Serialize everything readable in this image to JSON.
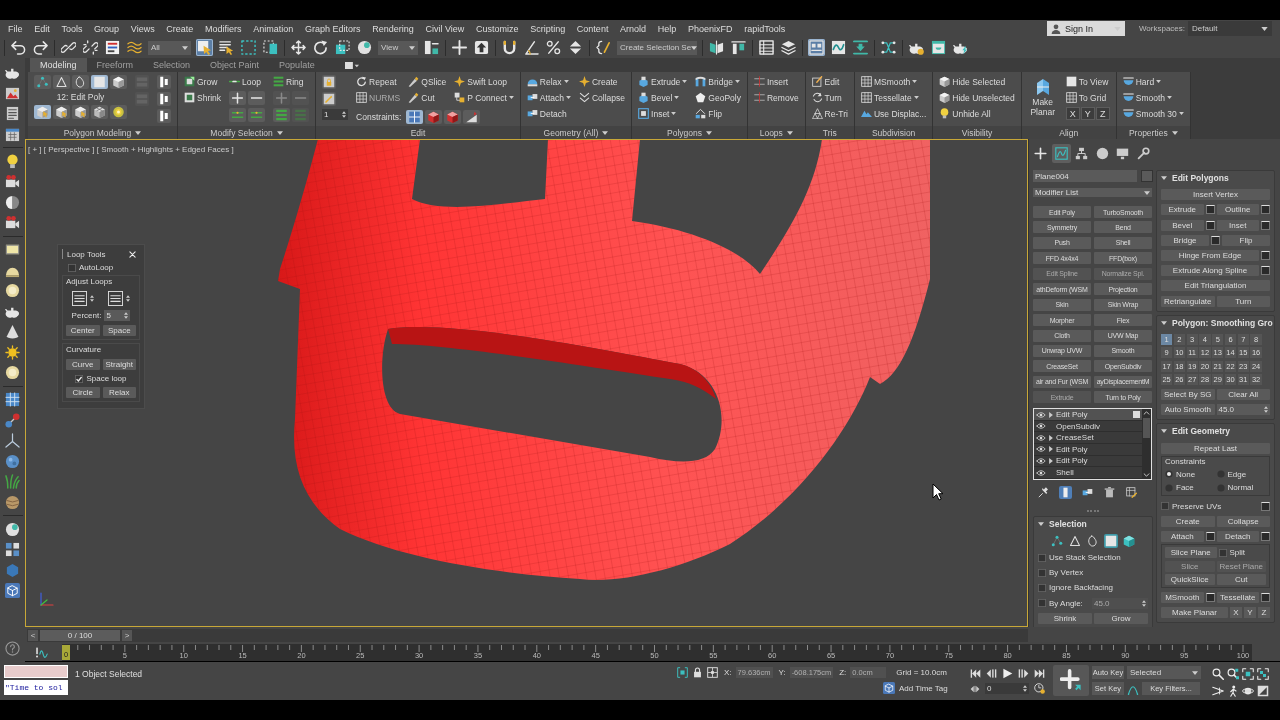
{
  "menu_bar": {
    "items": [
      "File",
      "Edit",
      "Tools",
      "Group",
      "Views",
      "Create",
      "Modifiers",
      "Animation",
      "Graph Editors",
      "Rendering",
      "Civil View",
      "Customize",
      "Scripting",
      "Content",
      "Arnold",
      "Help",
      "PhoenixFD",
      "rapidTools"
    ],
    "sign_in": "Sign In",
    "workspaces_label": "Workspaces:",
    "workspace": "Default"
  },
  "main_toolbar": {
    "selection_filter": "All",
    "select_object": true,
    "reference_coordinate": "View",
    "named_selection": "Create Selection Se",
    "ribbon_toggle": true
  },
  "ribbon": {
    "tabs": [
      {
        "label": "Modeling",
        "selected": true
      },
      {
        "label": "Freeform",
        "selected": false
      },
      {
        "label": "Selection",
        "selected": false
      },
      {
        "label": "Object Paint",
        "selected": false
      },
      {
        "label": "Populate",
        "selected": false
      }
    ],
    "panels": [
      {
        "title": "Polygon Modeling",
        "dropdown": true,
        "columns": [
          [
            {
              "kind": "tools",
              "tools": [
                {
                  "selected": false
                },
                {
                  "selected": false
                },
                {
                  "selected": false
                },
                {
                  "selected": true
                },
                {
                  "selected": false
                }
              ]
            },
            {
              "kind": "text",
              "label": "12: Edit Poly"
            },
            {
              "kind": "tools",
              "tools": [
                {
                  "selected": true
                },
                {
                  "selected": false
                },
                {
                  "selected": false
                },
                {
                  "selected": false
                },
                {
                  "selected": false
                }
              ]
            }
          ],
          [
            {
              "kind": "tool",
              "disabled": true
            },
            {
              "kind": "tool",
              "disabled": true
            }
          ],
          [
            {
              "kind": "tool",
              "disabled": false
            },
            {
              "kind": "tool",
              "disabled": false
            },
            {
              "kind": "tool",
              "disabled": false
            }
          ]
        ]
      },
      {
        "title": "Modify Selection",
        "dropdown": true,
        "columns": [
          [
            {
              "kind": "button",
              "label": "Grow",
              "dropdown": false,
              "disabled": false
            },
            {
              "kind": "button",
              "label": "Shrink",
              "dropdown": false,
              "disabled": false
            }
          ],
          [
            {
              "kind": "button",
              "label": "Loop",
              "dropdown": false,
              "disabled": false
            },
            {
              "kind": "tools",
              "tools": [
                {
                  "disabled": false
                },
                {
                  "disabled": false
                }
              ]
            },
            {
              "kind": "tools",
              "tools": [
                {
                  "disabled": false
                },
                {
                  "disabled": false
                }
              ]
            }
          ],
          [
            {
              "kind": "button",
              "label": "Ring",
              "dropdown": false,
              "disabled": false
            },
            {
              "kind": "tools",
              "tools": [
                {
                  "disabled": true
                },
                {
                  "disabled": true
                }
              ]
            },
            {
              "kind": "tools",
              "tools": [
                {
                  "disabled": false
                },
                {
                  "disabled": true
                }
              ]
            }
          ]
        ]
      },
      {
        "title": "Edit",
        "dropdown": false,
        "columns": [
          [
            {
              "kind": "tool",
              "disabled": false
            },
            {
              "kind": "tool",
              "disabled": false
            },
            {
              "kind": "spinner",
              "value": "1"
            }
          ],
          [
            {
              "kind": "button",
              "label": "Repeat",
              "dropdown": false,
              "disabled": false
            },
            {
              "kind": "button",
              "label": "NURMS",
              "dropdown": false,
              "disabled": true
            }
          ],
          [
            {
              "kind": "button",
              "label": "QSlice",
              "dropdown": false,
              "disabled": false
            },
            {
              "kind": "button",
              "label": "Cut",
              "dropdown": false,
              "disabled": false
            }
          ],
          [
            {
              "kind": "button",
              "label": "Swift Loop",
              "dropdown": false,
              "disabled": false
            },
            {
              "kind": "button",
              "label": "P Connect",
              "dropdown": true,
              "disabled": false
            }
          ]
        ],
        "footer": {
          "label": "Constraints:",
          "tools": [
            {
              "selected": true
            },
            {
              "selected": false
            },
            {
              "selected": false
            },
            {
              "selected": false
            }
          ]
        }
      },
      {
        "title": "Geometry (All)",
        "dropdown": true,
        "columns": [
          [
            {
              "kind": "button",
              "label": "Relax",
              "dropdown": true,
              "disabled": false
            },
            {
              "kind": "button",
              "label": "Attach",
              "dropdown": true,
              "disabled": false
            },
            {
              "kind": "button",
              "label": "Detach",
              "dropdown": false,
              "disabled": false
            }
          ],
          [
            {
              "kind": "button",
              "label": "Create",
              "dropdown": false,
              "disabled": false
            },
            {
              "kind": "button",
              "label": "Collapse",
              "dropdown": false,
              "disabled": false
            }
          ]
        ]
      },
      {
        "title": "Polygons",
        "dropdown": true,
        "columns": [
          [
            {
              "kind": "button",
              "label": "Extrude",
              "dropdown": true,
              "disabled": false
            },
            {
              "kind": "button",
              "label": "Bevel",
              "dropdown": true,
              "disabled": false
            },
            {
              "kind": "button",
              "label": "Inset",
              "dropdown": true,
              "disabled": false
            }
          ],
          [
            {
              "kind": "button",
              "label": "Bridge",
              "dropdown": true,
              "disabled": false
            },
            {
              "kind": "button",
              "label": "GeoPoly",
              "dropdown": false,
              "disabled": false
            },
            {
              "kind": "button",
              "label": "Flip",
              "dropdown": false,
              "disabled": false
            }
          ]
        ]
      },
      {
        "title": "Loops",
        "dropdown": true,
        "columns": [
          [
            {
              "kind": "button",
              "label": "Insert",
              "dropdown": false,
              "disabled": false
            },
            {
              "kind": "button",
              "label": "Remove",
              "dropdown": false,
              "disabled": false
            }
          ]
        ]
      },
      {
        "title": "Tris",
        "dropdown": false,
        "columns": [
          [
            {
              "kind": "button",
              "label": "Edit",
              "dropdown": false,
              "disabled": false
            },
            {
              "kind": "button",
              "label": "Turn",
              "dropdown": false,
              "disabled": false
            },
            {
              "kind": "button",
              "label": "Re-Tri",
              "dropdown": false,
              "disabled": false
            }
          ]
        ]
      },
      {
        "title": "Subdivision",
        "dropdown": false,
        "columns": [
          [
            {
              "kind": "button",
              "label": "MSmooth",
              "dropdown": true,
              "disabled": false
            },
            {
              "kind": "button",
              "label": "Tessellate",
              "dropdown": true,
              "disabled": false
            },
            {
              "kind": "button",
              "label": "Use Displac...",
              "dropdown": false,
              "disabled": false
            }
          ]
        ]
      },
      {
        "title": "Visibility",
        "dropdown": false,
        "columns": [
          [
            {
              "kind": "button",
              "label": "Hide Selected",
              "dropdown": false,
              "disabled": false
            },
            {
              "kind": "button",
              "label": "Hide Unselected",
              "dropdown": false,
              "disabled": false
            },
            {
              "kind": "button",
              "label": "Unhide All",
              "dropdown": false,
              "disabled": false
            }
          ]
        ]
      },
      {
        "title": "Align",
        "dropdown": false,
        "columns": [
          [
            {
              "kind": "big",
              "label": "Make Planar"
            }
          ],
          [
            {
              "kind": "button",
              "label": "To View",
              "dropdown": false,
              "disabled": false
            },
            {
              "kind": "button",
              "label": "To Grid",
              "dropdown": false,
              "disabled": false
            },
            {
              "kind": "keys",
              "labels": [
                "X",
                "Y",
                "Z"
              ]
            }
          ]
        ]
      },
      {
        "title": "Properties",
        "dropdown": true,
        "columns": [
          [
            {
              "kind": "button",
              "label": "Hard",
              "dropdown": true,
              "disabled": false
            },
            {
              "kind": "button",
              "label": "Smooth",
              "dropdown": true,
              "disabled": false
            },
            {
              "kind": "button",
              "label": "Smooth 30",
              "dropdown": true,
              "disabled": false
            }
          ]
        ]
      }
    ]
  },
  "viewport": {
    "label": "[ + ] [ Perspective ] [ Smooth + Highlights + Edged Faces ]",
    "active": true
  },
  "loop_tools": {
    "title": "Loop Tools",
    "autoloop": {
      "label": "AutoLoop",
      "checked": false
    },
    "adjust_loops": {
      "label": "Adjust Loops",
      "percent_label": "Percent:",
      "percent": "5",
      "buttons": [
        "Center",
        "Space"
      ]
    },
    "curvature": {
      "label": "Curvature",
      "buttons_top": [
        "Curve",
        "Straight"
      ],
      "space_loop": {
        "label": "Space loop",
        "checked": true
      },
      "buttons_bottom": [
        "Circle",
        "Relax"
      ]
    }
  },
  "command_panel": {
    "tabs": [
      {
        "selected": false
      },
      {
        "selected": true
      },
      {
        "selected": false
      },
      {
        "selected": false
      },
      {
        "selected": false
      },
      {
        "selected": false
      }
    ],
    "object_name": "Plane004",
    "modifier_list": "Modifier List",
    "modifier_buttons": [
      {
        "label": "Edit Poly",
        "disabled": false
      },
      {
        "label": "TurboSmooth",
        "disabled": false
      },
      {
        "label": "Symmetry",
        "disabled": false
      },
      {
        "label": "Bend",
        "disabled": false
      },
      {
        "label": "Push",
        "disabled": false
      },
      {
        "label": "Shell",
        "disabled": false
      },
      {
        "label": "FFD 4x4x4",
        "disabled": false
      },
      {
        "label": "FFD(box)",
        "disabled": false
      },
      {
        "label": "Edit Spline",
        "disabled": true
      },
      {
        "label": "Normalize Spl.",
        "disabled": true
      },
      {
        "label": "athDeform (WSM",
        "disabled": false
      },
      {
        "label": "Projection",
        "disabled": false
      },
      {
        "label": "Skin",
        "disabled": false
      },
      {
        "label": "Skin Wrap",
        "disabled": false
      },
      {
        "label": "Morpher",
        "disabled": false
      },
      {
        "label": "Flex",
        "disabled": false
      },
      {
        "label": "Cloth",
        "disabled": false
      },
      {
        "label": "UVW Map",
        "disabled": false
      },
      {
        "label": "Unwrap UVW",
        "disabled": false
      },
      {
        "label": "Smooth",
        "disabled": false
      },
      {
        "label": "CreaseSet",
        "disabled": false
      },
      {
        "label": "OpenSubdiv",
        "disabled": false
      },
      {
        "label": "air and Fur (WSM",
        "disabled": false
      },
      {
        "label": "ayDisplacementM",
        "disabled": false
      },
      {
        "label": "Extrude",
        "disabled": true
      },
      {
        "label": "Turn to Poly",
        "disabled": false
      }
    ],
    "stack": [
      {
        "label": "Edit Poly",
        "expandable": true,
        "selected": true
      },
      {
        "label": "OpenSubdiv",
        "expandable": false,
        "selected": false
      },
      {
        "label": "CreaseSet",
        "expandable": true,
        "selected": false
      },
      {
        "label": "Edit Poly",
        "expandable": true,
        "selected": false
      },
      {
        "label": "Edit Poly",
        "expandable": true,
        "selected": false
      },
      {
        "label": "Shell",
        "expandable": false,
        "selected": false
      }
    ],
    "stack_tools": [
      {
        "selected": false
      },
      {
        "selected": true
      },
      {
        "selected": false
      },
      {
        "selected": false
      },
      {
        "selected": false
      }
    ],
    "selection_rollout": {
      "title": "Selection",
      "rows": [
        {
          "kind": "tools",
          "tools": [
            {
              "selected": false
            },
            {
              "selected": false
            },
            {
              "selected": false
            },
            {
              "selected": true
            },
            {
              "selected": false
            }
          ]
        },
        {
          "kind": "row",
          "items": [
            {
              "kind": "check",
              "label": "Use Stack Selection",
              "checked": false
            }
          ]
        },
        {
          "kind": "row",
          "items": [
            {
              "kind": "check",
              "label": "By Vertex",
              "checked": false
            }
          ]
        },
        {
          "kind": "row",
          "items": [
            {
              "kind": "check",
              "label": "Ignore Backfacing",
              "checked": false
            }
          ]
        },
        {
          "kind": "row",
          "items": [
            {
              "kind": "check",
              "label": "By Angle:",
              "checked": false
            },
            {
              "kind": "spinner",
              "value": "45.0",
              "disabled": true
            }
          ]
        },
        {
          "kind": "row",
          "items": [
            {
              "kind": "button",
              "label": "Shrink",
              "disabled": false
            },
            {
              "kind": "button",
              "label": "Grow",
              "disabled": false
            }
          ]
        }
      ]
    },
    "rollouts": [
      {
        "title": "Edit Polygons",
        "rows": [
          {
            "kind": "row",
            "items": [
              {
                "kind": "button",
                "label": "Insert Vertex",
                "disabled": false
              }
            ]
          },
          {
            "kind": "row",
            "items": [
              {
                "kind": "button",
                "label": "Extrude",
                "disabled": false
              },
              {
                "kind": "settings"
              },
              {
                "kind": "button",
                "label": "Outline",
                "disabled": false
              },
              {
                "kind": "settings"
              }
            ]
          },
          {
            "kind": "row",
            "items": [
              {
                "kind": "button",
                "label": "Bevel",
                "disabled": false
              },
              {
                "kind": "settings"
              },
              {
                "kind": "button",
                "label": "Inset",
                "disabled": false
              },
              {
                "kind": "settings"
              }
            ]
          },
          {
            "kind": "row",
            "items": [
              {
                "kind": "button",
                "label": "Bridge",
                "disabled": false
              },
              {
                "kind": "settings"
              },
              {
                "kind": "button",
                "label": "Flip",
                "disabled": false
              }
            ]
          },
          {
            "kind": "row",
            "items": [
              {
                "kind": "button",
                "label": "Hinge From Edge",
                "disabled": false
              },
              {
                "kind": "settings"
              }
            ]
          },
          {
            "kind": "row",
            "items": [
              {
                "kind": "button",
                "label": "Extrude Along Spline",
                "disabled": false
              },
              {
                "kind": "settings"
              }
            ]
          },
          {
            "kind": "row",
            "items": [
              {
                "kind": "button",
                "label": "Edit Triangulation",
                "disabled": false
              }
            ]
          },
          {
            "kind": "row",
            "items": [
              {
                "kind": "button",
                "label": "Retriangulate",
                "disabled": false
              },
              {
                "kind": "button",
                "label": "Turn",
                "disabled": false
              }
            ]
          }
        ]
      },
      {
        "title": "Polygon: Smoothing Gro",
        "rows": [
          {
            "kind": "groups",
            "groups": [
              {
                "label": "1",
                "selected": true
              },
              {
                "label": "2",
                "selected": false
              },
              {
                "label": "3",
                "selected": false
              },
              {
                "label": "4",
                "selected": false
              },
              {
                "label": "5",
                "selected": false
              },
              {
                "label": "6",
                "selected": false
              },
              {
                "label": "7",
                "selected": false
              },
              {
                "label": "8",
                "selected": false
              },
              {
                "label": "9",
                "selected": false
              },
              {
                "label": "10",
                "selected": false
              },
              {
                "label": "11",
                "selected": false
              },
              {
                "label": "12",
                "selected": false
              },
              {
                "label": "13",
                "selected": false
              },
              {
                "label": "14",
                "selected": false
              },
              {
                "label": "15",
                "selected": false
              },
              {
                "label": "16",
                "selected": false
              },
              {
                "label": "17",
                "selected": false
              },
              {
                "label": "18",
                "selected": false
              },
              {
                "label": "19",
                "selected": false
              },
              {
                "label": "20",
                "selected": false
              },
              {
                "label": "21",
                "selected": false
              },
              {
                "label": "22",
                "selected": false
              },
              {
                "label": "23",
                "selected": false
              },
              {
                "label": "24",
                "selected": false
              },
              {
                "label": "25",
                "selected": false
              },
              {
                "label": "26",
                "selected": false
              },
              {
                "label": "27",
                "selected": false
              },
              {
                "label": "28",
                "selected": false
              },
              {
                "label": "29",
                "selected": false
              },
              {
                "label": "30",
                "selected": false
              },
              {
                "label": "31",
                "selected": false
              },
              {
                "label": "32",
                "selected": false
              }
            ]
          },
          {
            "kind": "row",
            "items": [
              {
                "kind": "button",
                "label": "Select By SG",
                "disabled": false
              },
              {
                "kind": "button",
                "label": "Clear All",
                "disabled": false
              }
            ]
          },
          {
            "kind": "row",
            "items": [
              {
                "kind": "button",
                "label": "Auto Smooth",
                "disabled": false
              },
              {
                "kind": "spinner",
                "value": "45.0",
                "disabled": false
              }
            ]
          }
        ]
      },
      {
        "title": "Edit Geometry",
        "rows": [
          {
            "kind": "row",
            "items": [
              {
                "kind": "button",
                "label": "Repeat Last",
                "disabled": false
              }
            ]
          },
          {
            "kind": "group",
            "label": "Constraints",
            "rows": [
              {
                "kind": "row",
                "items": [
                  {
                    "kind": "radio",
                    "label": "None",
                    "selected": true
                  },
                  {
                    "kind": "radio",
                    "label": "Edge",
                    "selected": false
                  }
                ]
              },
              {
                "kind": "row",
                "items": [
                  {
                    "kind": "radio",
                    "label": "Face",
                    "selected": false
                  },
                  {
                    "kind": "radio",
                    "label": "Normal",
                    "selected": false
                  }
                ]
              }
            ]
          },
          {
            "kind": "row",
            "items": [
              {
                "kind": "check",
                "label": "Preserve UVs",
                "checked": false
              },
              {
                "kind": "settings"
              }
            ]
          },
          {
            "kind": "row",
            "items": [
              {
                "kind": "button",
                "label": "Create",
                "disabled": false
              },
              {
                "kind": "button",
                "label": "Collapse",
                "disabled": false
              }
            ]
          },
          {
            "kind": "row",
            "items": [
              {
                "kind": "button",
                "label": "Attach",
                "disabled": false
              },
              {
                "kind": "settings"
              },
              {
                "kind": "button",
                "label": "Detach",
                "disabled": false
              },
              {
                "kind": "settings"
              }
            ]
          },
          {
            "kind": "group",
            "rows": [
              {
                "kind": "row",
                "items": [
                  {
                    "kind": "button",
                    "label": "Slice Plane",
                    "disabled": false
                  },
                  {
                    "kind": "check",
                    "label": "Split",
                    "checked": false
                  }
                ]
              },
              {
                "kind": "row",
                "items": [
                  {
                    "kind": "button",
                    "label": "Slice",
                    "disabled": true
                  },
                  {
                    "kind": "button",
                    "label": "Reset Plane",
                    "disabled": true
                  }
                ]
              },
              {
                "kind": "row",
                "items": [
                  {
                    "kind": "button",
                    "label": "QuickSlice",
                    "disabled": false
                  },
                  {
                    "kind": "button",
                    "label": "Cut",
                    "disabled": false
                  }
                ]
              }
            ]
          },
          {
            "kind": "row",
            "items": [
              {
                "kind": "button",
                "label": "MSmooth",
                "disabled": false
              },
              {
                "kind": "settings"
              },
              {
                "kind": "button",
                "label": "Tessellate",
                "disabled": false
              },
              {
                "kind": "settings"
              }
            ]
          },
          {
            "kind": "row",
            "items": [
              {
                "kind": "button",
                "label": "Make Planar",
                "disabled": false
              },
              {
                "kind": "key",
                "label": "X"
              },
              {
                "kind": "key",
                "label": "Y"
              },
              {
                "kind": "key",
                "label": "Z"
              }
            ]
          }
        ]
      }
    ]
  },
  "time_slider": {
    "prev": "<",
    "position": "0 / 100",
    "next": ">"
  },
  "track_bar": {
    "labels": [
      "0",
      "5",
      "10",
      "15",
      "20",
      "25",
      "30",
      "35",
      "40",
      "45",
      "50",
      "55",
      "60",
      "65",
      "70",
      "75",
      "80",
      "85",
      "90",
      "95",
      "100"
    ]
  },
  "status_bar": {
    "listener_input": "\"Time to sol",
    "prompt": "1 Object Selected",
    "coordinates": [
      {
        "axis": "X:",
        "value": "79.636cm"
      },
      {
        "axis": "Y:",
        "value": "-608.175cm"
      },
      {
        "axis": "Z:",
        "value": "0.0cm"
      }
    ],
    "coordinates_disabled": true,
    "grid": "Grid = 10.0cm",
    "time_tag": "Add Time Tag",
    "frame": "0",
    "auto_key": "Auto Key",
    "key_mode": "Selected",
    "set_key": "Set Key",
    "key_filters": "Key Filters..."
  }
}
